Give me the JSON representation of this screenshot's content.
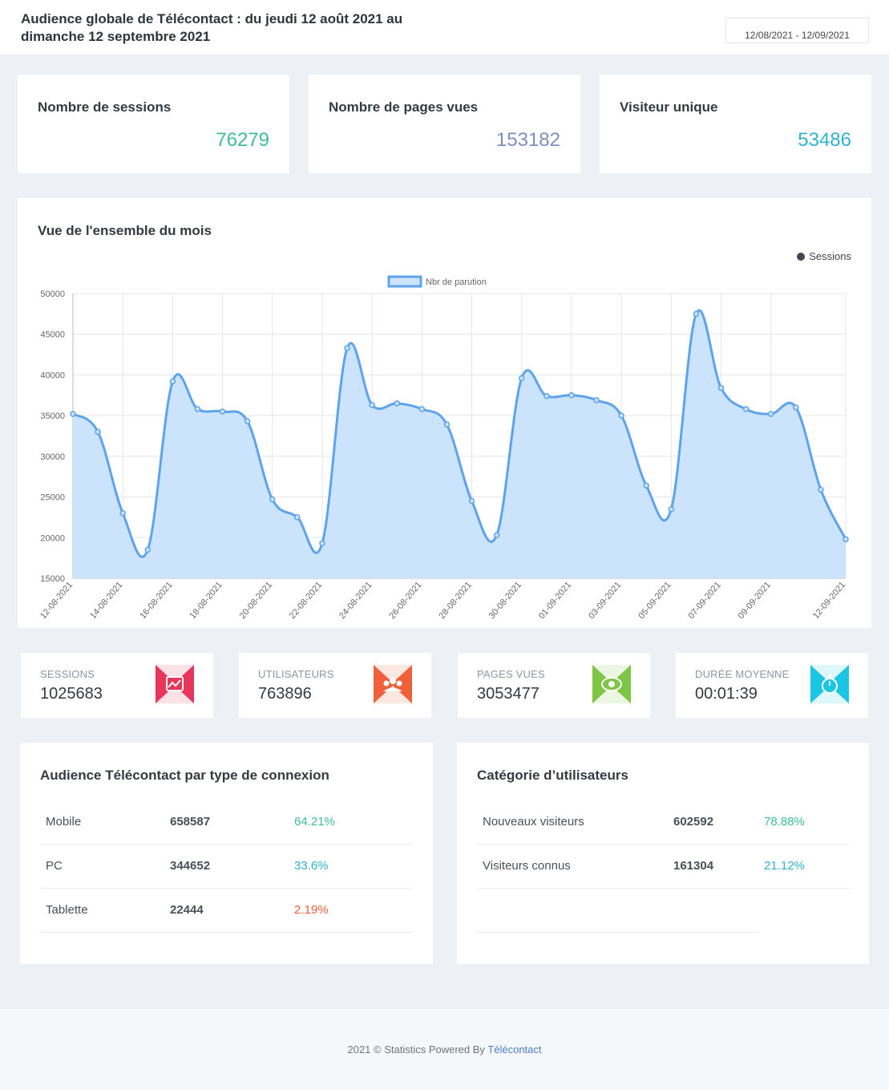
{
  "header": {
    "title": "Audience globale de Télécontact : du jeudi 12 août 2021 au dimanche 12 septembre 2021",
    "date_range": "12/08/2021 - 12/09/2021"
  },
  "kpis": [
    {
      "label": "Nombre de sessions",
      "value": "76279",
      "color": "#3dbf8f"
    },
    {
      "label": "Nombre de pages vues",
      "value": "153182",
      "color": "#7f8ec0"
    },
    {
      "label": "Visiteur unique",
      "value": "53486",
      "color": "#2fb3cf"
    }
  ],
  "chart_card": {
    "title": "Vue de l'ensemble du mois",
    "tag": "Sessions"
  },
  "chart_data": {
    "type": "area",
    "legend": "Nbr de parution",
    "legend_position": "top-center",
    "grid": true,
    "ylim": [
      15000,
      50000
    ],
    "yticks": [
      15000,
      20000,
      25000,
      30000,
      35000,
      40000,
      45000,
      50000
    ],
    "x_labels_shown": [
      "12-08-2021",
      "14-08-2021",
      "16-08-2021",
      "18-08-2021",
      "20-08-2021",
      "22-08-2021",
      "24-08-2021",
      "26-08-2021",
      "28-08-2021",
      "30-08-2021",
      "01-09-2021",
      "03-09-2021",
      "05-09-2021",
      "07-09-2021",
      "09-09-2021",
      "12-09-2021"
    ],
    "x": [
      "12-08-2021",
      "13-08-2021",
      "14-08-2021",
      "15-08-2021",
      "16-08-2021",
      "17-08-2021",
      "18-08-2021",
      "19-08-2021",
      "20-08-2021",
      "21-08-2021",
      "22-08-2021",
      "23-08-2021",
      "24-08-2021",
      "25-08-2021",
      "26-08-2021",
      "27-08-2021",
      "28-08-2021",
      "29-08-2021",
      "30-08-2021",
      "31-08-2021",
      "01-09-2021",
      "02-09-2021",
      "03-09-2021",
      "04-09-2021",
      "05-09-2021",
      "06-09-2021",
      "07-09-2021",
      "08-09-2021",
      "09-09-2021",
      "10-09-2021",
      "11-09-2021",
      "12-09-2021"
    ],
    "series": [
      {
        "name": "Nbr de parution",
        "values": [
          35200,
          33000,
          23000,
          18500,
          39200,
          35800,
          35500,
          34300,
          24700,
          22500,
          19300,
          43300,
          36300,
          36500,
          35800,
          33900,
          24500,
          20300,
          39600,
          37400,
          37500,
          36900,
          35000,
          26400,
          23500,
          47500,
          38400,
          35800,
          35200,
          36000,
          25900,
          19800
        ]
      }
    ],
    "line_color": "#5da4ec",
    "fill_color": "#cce3fc"
  },
  "stats": [
    {
      "label": "SESSIONS",
      "value": "1025683",
      "icon": "chart-icon",
      "color": "#e8365a"
    },
    {
      "label": "UTILISATEURS",
      "value": "763896",
      "icon": "users-icon",
      "color": "#f0603a"
    },
    {
      "label": "PAGES VUES",
      "value": "3053477",
      "icon": "eye-icon",
      "color": "#7ec545"
    },
    {
      "label": "DURÉE MOYENNE",
      "value": "00:01:39",
      "icon": "stopwatch-icon",
      "color": "#1bc5e4"
    }
  ],
  "connection_table": {
    "title": "Audience Télécontact par type de connexion",
    "rows": [
      {
        "label": "Mobile",
        "count": "658587",
        "pct": "64.21%",
        "color": "#3dbf8f"
      },
      {
        "label": "PC",
        "count": "344652",
        "pct": "33.6%",
        "color": "#2fb3cf"
      },
      {
        "label": "Tablette",
        "count": "22444",
        "pct": "2.19%",
        "color": "#f0603a"
      }
    ]
  },
  "users_table": {
    "title": "Catégorie d’utilisateurs",
    "rows": [
      {
        "label": "Nouveaux visiteurs",
        "count": "602592",
        "pct": "78.88%",
        "color": "#3dbf8f"
      },
      {
        "label": "Visiteurs connus",
        "count": "161304",
        "pct": "21.12%",
        "color": "#2fb3cf"
      }
    ]
  },
  "footer": {
    "text": "2021 © Statistics Powered By ",
    "link": "Télécontact"
  }
}
